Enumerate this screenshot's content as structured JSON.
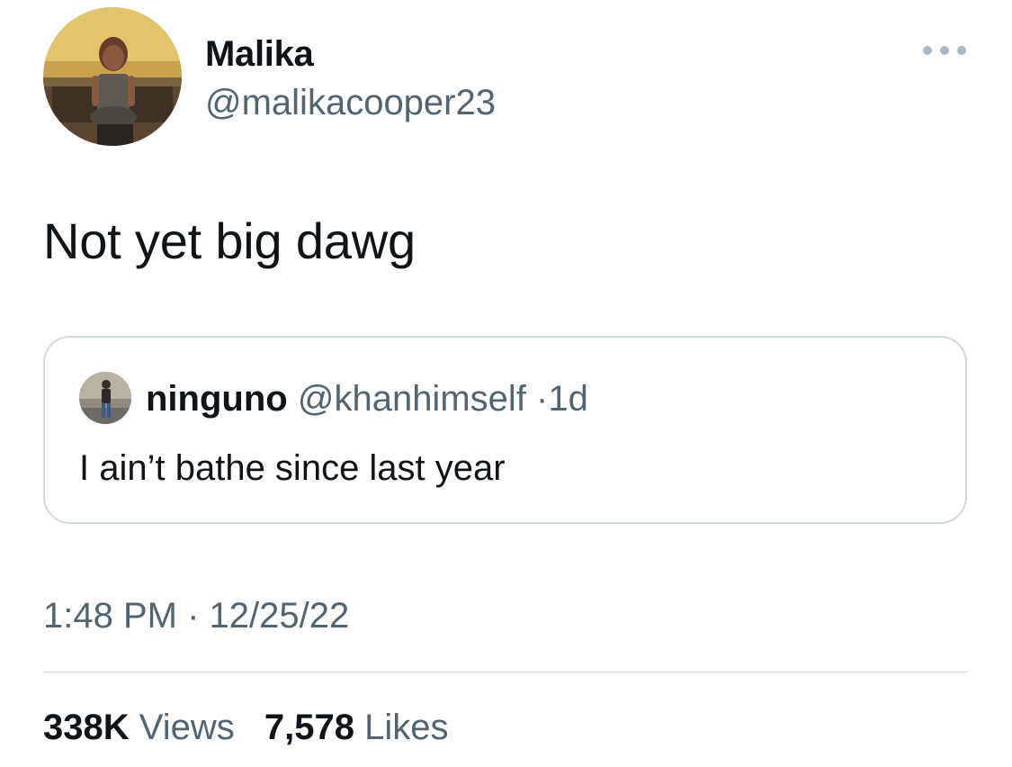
{
  "author": {
    "name": "Malika",
    "handle": "@malikacooper23"
  },
  "tweet": {
    "text": "Not yet big dawg"
  },
  "quote": {
    "name": "ninguno",
    "handle": "@khanhimself",
    "separator": "·",
    "time": "1d",
    "text": "I ain’t bathe since last year"
  },
  "meta": {
    "time": "1:48 PM",
    "separator": "·",
    "date": "12/25/22"
  },
  "stats": {
    "views_value": "338K",
    "views_label": "Views",
    "likes_value": "7,578",
    "likes_label": "Likes"
  },
  "icons": {
    "more": "more-horizontal-icon"
  },
  "colors": {
    "text": "#0f1419",
    "secondary": "#536471",
    "border": "#cfd9de",
    "more_dots": "#aab8c2"
  }
}
